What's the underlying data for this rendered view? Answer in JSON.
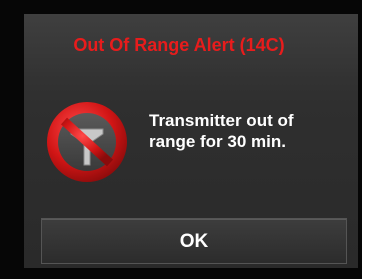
{
  "dialog": {
    "title": "Out Of Range Alert (14C)",
    "message_line1": "Transmitter out of",
    "message_line2": "range for 30 min.",
    "icon": "no-signal-antenna-icon",
    "ok_label": "OK"
  },
  "colors": {
    "title": "#e81c1c",
    "icon_ring": "#d11515",
    "background": "#060606",
    "panel": "#2f2f2f",
    "text": "#ffffff"
  }
}
